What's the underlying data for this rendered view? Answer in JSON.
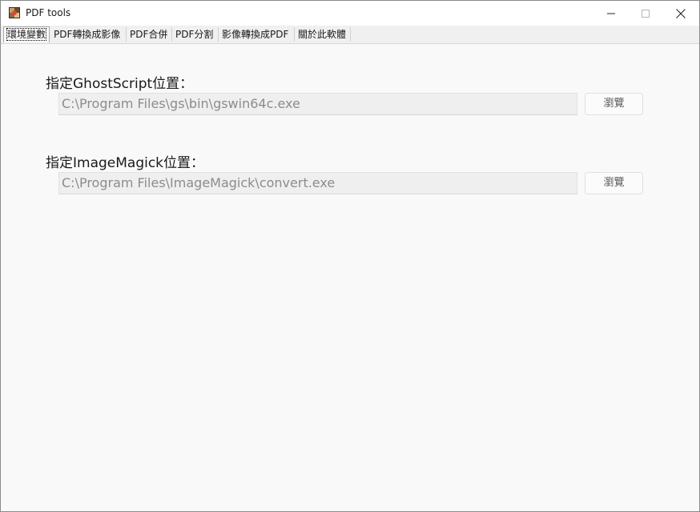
{
  "window": {
    "title": "PDF tools",
    "icon": "pdf-tools-app-icon",
    "controls": {
      "minimize_icon": "minimize-icon",
      "maximize_icon": "maximize-icon",
      "close_icon": "close-icon"
    }
  },
  "tabs": [
    {
      "label": "環境變數",
      "active": true
    },
    {
      "label": "PDF轉換成影像",
      "active": false
    },
    {
      "label": "PDF合併",
      "active": false
    },
    {
      "label": "PDF分割",
      "active": false
    },
    {
      "label": "影像轉換成PDF",
      "active": false
    },
    {
      "label": "關於此軟體",
      "active": false
    }
  ],
  "settings": {
    "ghostscript": {
      "label": "指定GhostScript位置：",
      "path": "C:\\Program Files\\gs\\bin\\gswin64c.exe",
      "browse_label": "瀏覽"
    },
    "imagemagick": {
      "label": "指定ImageMagick位置：",
      "path": "C:\\Program Files\\ImageMagick\\convert.exe",
      "browse_label": "瀏覽"
    }
  },
  "colors": {
    "window_bg": "#f9f9f9",
    "titlebar_bg": "#ffffff",
    "disabled_text": "#8c8c8c",
    "field_bg": "#efefef"
  }
}
